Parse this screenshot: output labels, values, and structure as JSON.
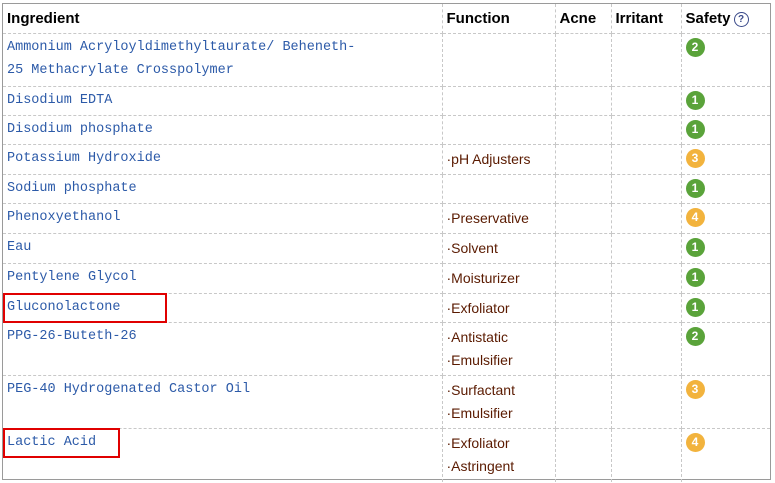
{
  "headers": {
    "ingredient": "Ingredient",
    "function": "Function",
    "acne": "Acne",
    "irritant": "Irritant",
    "safety": "Safety",
    "help_glyph": "?"
  },
  "colors": {
    "safety_1": "#5aa33a",
    "safety_2": "#5aa33a",
    "safety_3": "#f2b33d",
    "safety_4": "#f2b33d"
  },
  "rows": [
    {
      "ingredient": "Ammonium Acryloyldimethyltaurate/ Beheneth-25 Methacrylate Crosspolymer",
      "functions": [],
      "acne": "",
      "irritant": "",
      "safety": "2"
    },
    {
      "ingredient": "Disodium EDTA",
      "functions": [],
      "acne": "",
      "irritant": "",
      "safety": "1"
    },
    {
      "ingredient": "Disodium phosphate",
      "functions": [],
      "acne": "",
      "irritant": "",
      "safety": "1"
    },
    {
      "ingredient": "Potassium Hydroxide",
      "functions": [
        "·pH Adjusters"
      ],
      "acne": "",
      "irritant": "",
      "safety": "3"
    },
    {
      "ingredient": "Sodium phosphate",
      "functions": [],
      "acne": "",
      "irritant": "",
      "safety": "1"
    },
    {
      "ingredient": "Phenoxyethanol",
      "functions": [
        "·Preservative"
      ],
      "acne": "",
      "irritant": "",
      "safety": "4"
    },
    {
      "ingredient": "Eau",
      "functions": [
        "·Solvent"
      ],
      "acne": "",
      "irritant": "",
      "safety": "1"
    },
    {
      "ingredient": "Pentylene Glycol",
      "functions": [
        "·Moisturizer"
      ],
      "acne": "",
      "irritant": "",
      "safety": "1"
    },
    {
      "ingredient": "Gluconolactone",
      "functions": [
        "·Exfoliator"
      ],
      "acne": "",
      "irritant": "",
      "safety": "1",
      "highlighted": true
    },
    {
      "ingredient": "PPG-26-Buteth-26",
      "functions": [
        "·Antistatic",
        "·Emulsifier"
      ],
      "acne": "",
      "irritant": "",
      "safety": "2"
    },
    {
      "ingredient": "PEG-40 Hydrogenated Castor Oil",
      "functions": [
        "·Surfactant",
        "·Emulsifier"
      ],
      "acne": "",
      "irritant": "",
      "safety": "3"
    },
    {
      "ingredient": "Lactic Acid",
      "functions": [
        "·Exfoliator",
        "·Astringent"
      ],
      "acne": "",
      "irritant": "",
      "safety": "4",
      "highlighted": true
    }
  ]
}
